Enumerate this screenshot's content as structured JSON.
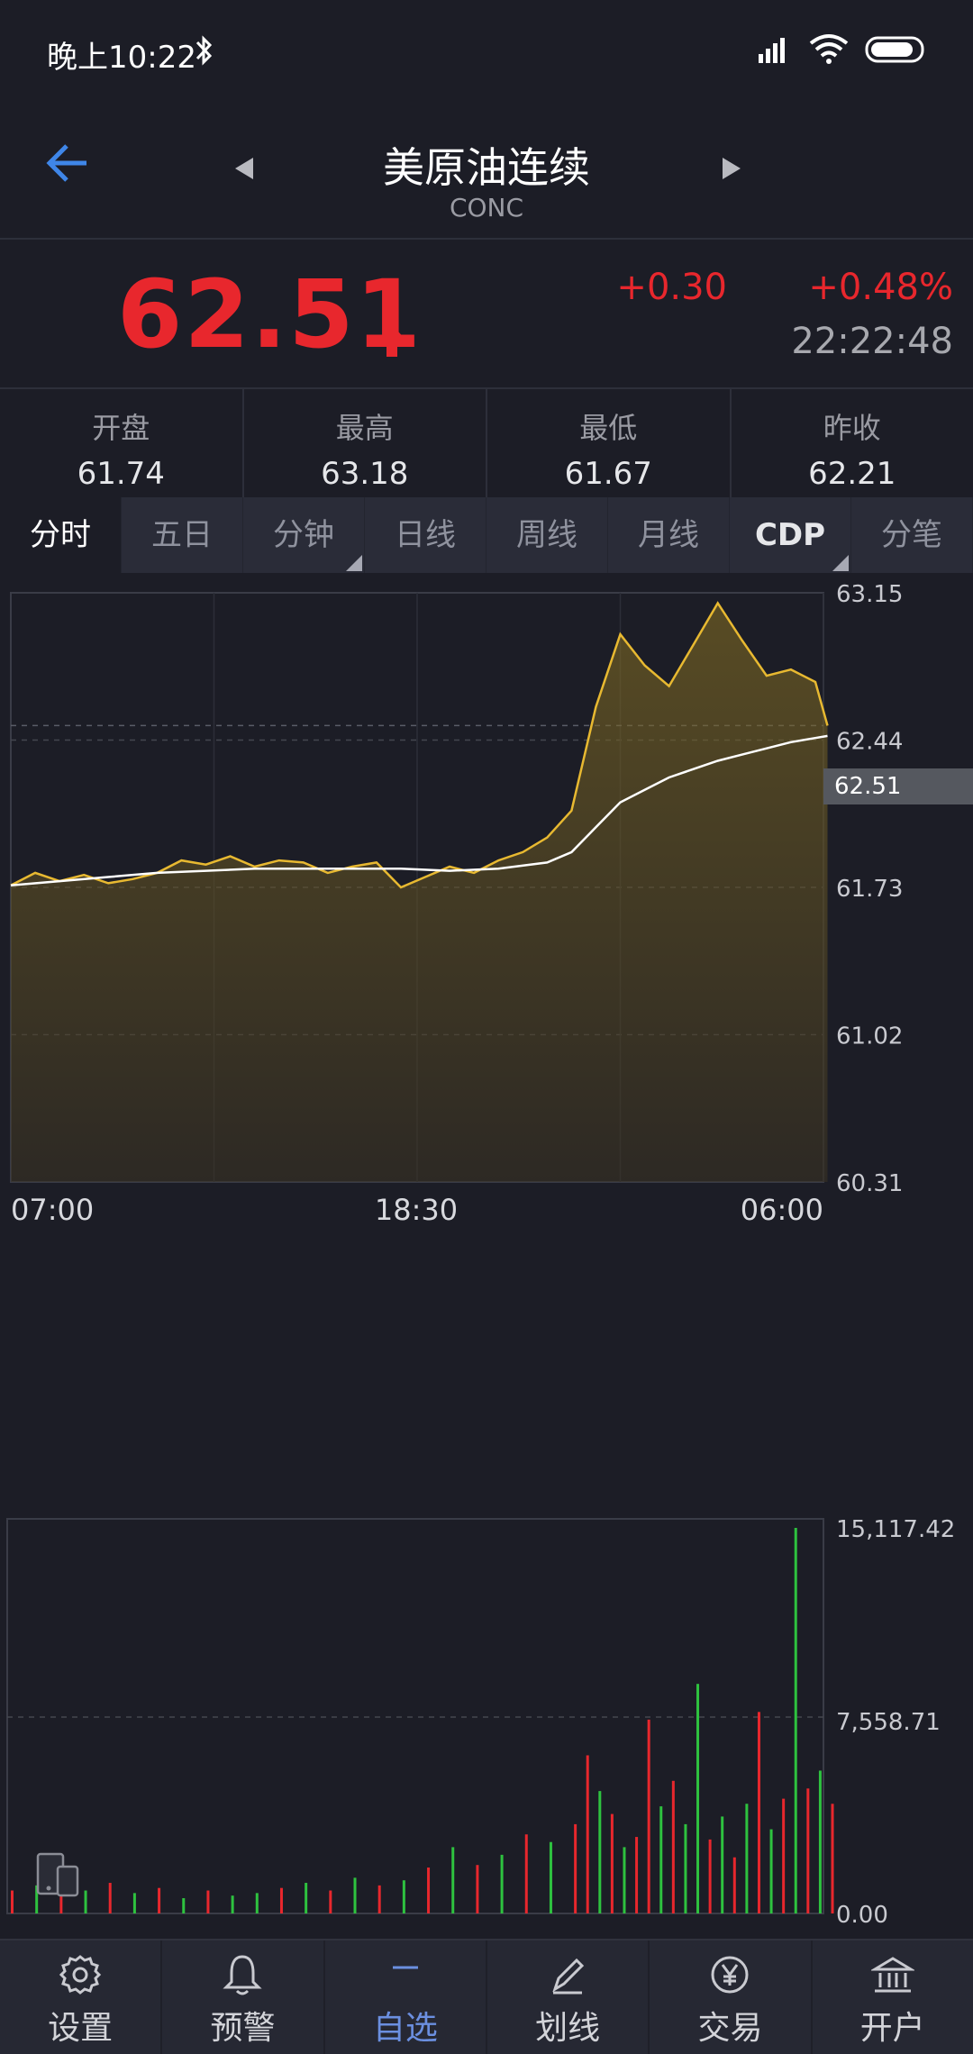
{
  "status_bar": {
    "time": "晚上10:22"
  },
  "header": {
    "title": "美原油连续",
    "code": "CONC"
  },
  "quote": {
    "price": "62.51",
    "change": "+0.30",
    "change_pct": "+0.48%",
    "time": "22:22:48",
    "up_color": "#e8272d"
  },
  "stats": [
    {
      "label": "开盘",
      "value": "61.74"
    },
    {
      "label": "最高",
      "value": "63.18"
    },
    {
      "label": "最低",
      "value": "61.67"
    },
    {
      "label": "昨收",
      "value": "62.21"
    }
  ],
  "tabs": [
    {
      "label": "分时",
      "active": true
    },
    {
      "label": "五日"
    },
    {
      "label": "分钟",
      "dropdown": true
    },
    {
      "label": "日线"
    },
    {
      "label": "周线"
    },
    {
      "label": "月线"
    },
    {
      "label": "CDP",
      "dropdown": true
    },
    {
      "label": "分笔"
    }
  ],
  "chart_data": [
    {
      "type": "line",
      "y_ticks": [
        "63.15",
        "62.44",
        "61.73",
        "61.02",
        "60.31"
      ],
      "x_ticks": [
        "07:00",
        "18:30",
        "06:00"
      ],
      "ylim": [
        60.31,
        63.15
      ],
      "current_label": "62.51",
      "grid": true,
      "series": [
        {
          "role": "price",
          "color": "#e8b931",
          "x": [
            0,
            2,
            4,
            6,
            8,
            10,
            12,
            14,
            16,
            18,
            20,
            22,
            24,
            26,
            28,
            30,
            32,
            34,
            36,
            38,
            40,
            42,
            44,
            46,
            48,
            50,
            52,
            54,
            56,
            58,
            60,
            62,
            64,
            66,
            67
          ],
          "values": [
            61.74,
            61.8,
            61.76,
            61.79,
            61.75,
            61.77,
            61.8,
            61.86,
            61.84,
            61.88,
            61.83,
            61.86,
            61.85,
            61.8,
            61.83,
            61.85,
            61.73,
            61.78,
            61.83,
            61.8,
            61.86,
            61.9,
            61.97,
            62.1,
            62.6,
            62.95,
            62.8,
            62.7,
            62.9,
            63.1,
            62.92,
            62.75,
            62.78,
            62.72,
            62.51
          ]
        },
        {
          "role": "average",
          "color": "#ffffff",
          "x": [
            0,
            4,
            8,
            12,
            16,
            20,
            24,
            28,
            32,
            36,
            40,
            44,
            46,
            48,
            50,
            52,
            54,
            56,
            58,
            60,
            62,
            64,
            66,
            67
          ],
          "values": [
            61.74,
            61.76,
            61.78,
            61.8,
            61.81,
            61.82,
            61.82,
            61.82,
            61.82,
            61.81,
            61.82,
            61.85,
            61.9,
            62.02,
            62.14,
            62.2,
            62.26,
            62.3,
            62.34,
            62.37,
            62.4,
            62.43,
            62.45,
            62.46
          ]
        }
      ]
    },
    {
      "type": "bar",
      "y_ticks": [
        "15,117.42",
        "7,558.71",
        "0.00"
      ],
      "ylim": [
        0,
        15117.42
      ],
      "colors": {
        "up": "#e8272d",
        "down": "#2ec23f"
      },
      "x": [
        0,
        2,
        4,
        6,
        8,
        10,
        12,
        14,
        16,
        18,
        20,
        22,
        24,
        26,
        28,
        30,
        32,
        34,
        36,
        38,
        40,
        42,
        44,
        46,
        47,
        48,
        49,
        50,
        51,
        52,
        53,
        54,
        55,
        56,
        57,
        58,
        59,
        60,
        61,
        62,
        63,
        64,
        65,
        66,
        67
      ],
      "values": [
        900,
        1100,
        700,
        900,
        1200,
        800,
        1000,
        600,
        900,
        700,
        800,
        1000,
        1200,
        900,
        1400,
        1100,
        1300,
        1800,
        2600,
        1900,
        2300,
        3100,
        2800,
        3500,
        6200,
        4800,
        3900,
        2600,
        3000,
        7600,
        4200,
        5200,
        3500,
        9000,
        2900,
        3800,
        2200,
        4300,
        7900,
        3300,
        4500,
        15117.42,
        4900,
        5600,
        4300
      ],
      "up": [
        true,
        false,
        true,
        false,
        true,
        false,
        true,
        false,
        true,
        false,
        false,
        true,
        false,
        true,
        false,
        true,
        false,
        true,
        false,
        true,
        false,
        true,
        false,
        true,
        true,
        false,
        true,
        false,
        true,
        true,
        false,
        true,
        false,
        false,
        true,
        false,
        true,
        false,
        true,
        false,
        true,
        false,
        true,
        false,
        true
      ]
    }
  ],
  "nav": [
    {
      "label": "设置",
      "icon": "gear-icon"
    },
    {
      "label": "预警",
      "icon": "bell-icon"
    },
    {
      "label": "自选",
      "icon": "minus-icon",
      "active": true
    },
    {
      "label": "划线",
      "icon": "pen-icon"
    },
    {
      "label": "交易",
      "icon": "yen-icon"
    },
    {
      "label": "开户",
      "icon": "bank-icon"
    }
  ]
}
